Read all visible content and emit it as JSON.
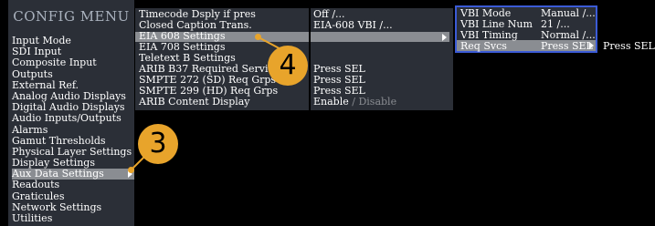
{
  "config_menu": {
    "title": "CONFIG MENU",
    "items": [
      "Input Mode",
      "SDI Input",
      "Composite Input",
      "Outputs",
      "External Ref.",
      "Analog Audio Displays",
      "Digital Audio Displays",
      "Audio Inputs/Outputs",
      "Alarms",
      "Gamut Thresholds",
      "Physical Layer Settings",
      "Display Settings",
      "Aux Data Settings",
      "Readouts",
      "Graticules",
      "Network Settings",
      "Utilities"
    ],
    "selected_index": 12
  },
  "aux_menu": {
    "items": [
      "Timecode Dsply if pres",
      "Closed Caption Trans.",
      "EIA 608 Settings",
      "EIA 708 Settings",
      "Teletext B Settings",
      "ARIB B37 Required Servic",
      "SMPTE 272 (SD) Req Grps",
      "SMPTE 299 (HD) Req Grps",
      "ARIB Content Display"
    ],
    "selected_index": 2
  },
  "aux_values": {
    "timecode": "Off /...",
    "closed_caption": "EIA-608 VBI /...",
    "arib_b37": "Press SEL",
    "smpte272": "Press SEL",
    "smpte299": "Press SEL",
    "arib_content_enable": "Enable",
    "arib_content_sep": "/",
    "arib_content_disable": "Disable"
  },
  "vbi_submenu": {
    "rows": [
      {
        "label": "VBI Mode",
        "value": "Manual /..."
      },
      {
        "label": "VBI Line Num",
        "value": "21  /..."
      },
      {
        "label": "VBI Timing",
        "value": "Normal /..."
      },
      {
        "label": "Req Svcs",
        "value": "Press SEL"
      }
    ],
    "selected_index": 3
  },
  "press_sel_outside": "Press SEL",
  "callouts": [
    "3",
    "4"
  ],
  "colors": {
    "panel_bg": "#2b2f37",
    "highlight": "#8a8d92",
    "title_text": "#aab2be",
    "vbi_border": "#3b5bd6",
    "callout": "#e8a42b"
  }
}
